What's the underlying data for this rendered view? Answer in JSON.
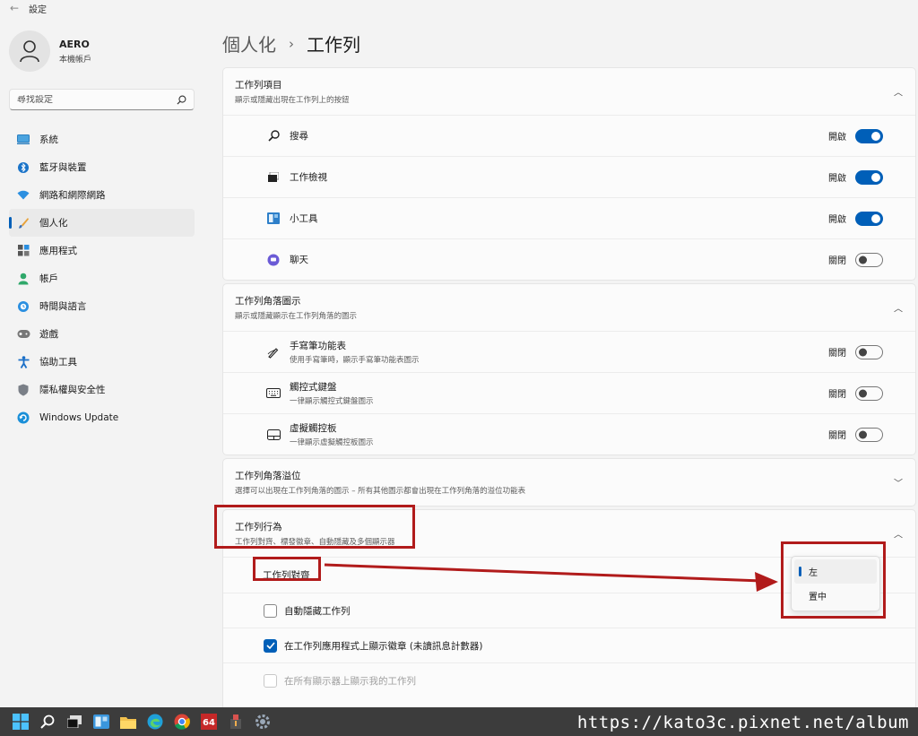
{
  "window": {
    "title": "設定"
  },
  "profile": {
    "name": "AERO",
    "account": "本機帳戶"
  },
  "search": {
    "placeholder": "尋找設定"
  },
  "nav": [
    {
      "label": "系統",
      "icon": "monitor-icon"
    },
    {
      "label": "藍牙與裝置",
      "icon": "bluetooth-icon"
    },
    {
      "label": "網路和網際網路",
      "icon": "wifi-icon"
    },
    {
      "label": "個人化",
      "icon": "brush-icon",
      "active": true
    },
    {
      "label": "應用程式",
      "icon": "apps-icon"
    },
    {
      "label": "帳戶",
      "icon": "person-icon"
    },
    {
      "label": "時間與語言",
      "icon": "globe-clock-icon"
    },
    {
      "label": "遊戲",
      "icon": "gamepad-icon"
    },
    {
      "label": "協助工具",
      "icon": "accessibility-icon"
    },
    {
      "label": "隱私權與安全性",
      "icon": "shield-icon"
    },
    {
      "label": "Windows Update",
      "icon": "update-icon"
    }
  ],
  "breadcrumb": {
    "parent": "個人化",
    "separator": "›",
    "current": "工作列"
  },
  "sections": {
    "taskbar_items": {
      "title": "工作列項目",
      "subtitle": "顯示或隱藏出現在工作列上的按鈕",
      "rows": [
        {
          "label": "搜尋",
          "state": "開啟"
        },
        {
          "label": "工作檢視",
          "state": "開啟"
        },
        {
          "label": "小工具",
          "state": "開啟"
        },
        {
          "label": "聊天",
          "state": "關閉"
        }
      ]
    },
    "corner_icons": {
      "title": "工作列角落圖示",
      "subtitle": "顯示或隱藏顯示在工作列角落的圖示",
      "rows": [
        {
          "label": "手寫筆功能表",
          "sub": "使用手寫筆時，顯示手寫筆功能表圖示",
          "state": "關閉"
        },
        {
          "label": "觸控式鍵盤",
          "sub": "一律顯示觸控式鍵盤圖示",
          "state": "關閉"
        },
        {
          "label": "虛擬觸控板",
          "sub": "一律顯示虛擬觸控板圖示",
          "state": "關閉"
        }
      ]
    },
    "corner_overflow": {
      "title": "工作列角落溢位",
      "subtitle": "選擇可以出現在工作列角落的圖示 – 所有其他圖示都會出現在工作列角落的溢位功能表"
    },
    "behaviors": {
      "title": "工作列行為",
      "subtitle": "工作列對齊、標發徽章、自動隱藏及多個顯示器",
      "alignment_label": "工作列對齊",
      "checkboxes": [
        {
          "label": "自動隱藏工作列",
          "checked": false,
          "disabled": false
        },
        {
          "label": "在工作列應用程式上顯示徽章 (未讀訊息計數器)",
          "checked": true,
          "disabled": false
        },
        {
          "label": "在所有顯示器上顯示我的工作列",
          "checked": false,
          "disabled": true
        }
      ]
    }
  },
  "alignment_dropdown": {
    "options": [
      "左",
      "置中"
    ],
    "selected": "左"
  },
  "annotation": {
    "color": "#b11b1b"
  },
  "accent": "#005fb8",
  "watermark": "https://kato3c.pixnet.net/album"
}
